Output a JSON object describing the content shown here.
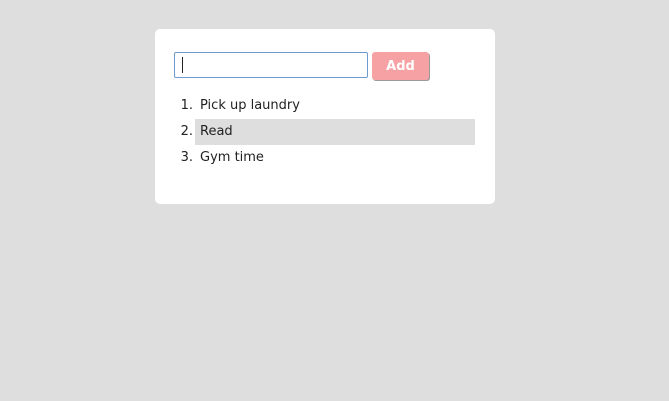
{
  "input": {
    "value": "",
    "placeholder": ""
  },
  "add_button": {
    "label": "Add",
    "color": "#f6a1a3"
  },
  "todos": [
    {
      "number": "1.",
      "text": "Pick up laundry",
      "selected": false
    },
    {
      "number": "2.",
      "text": "Read",
      "selected": true
    },
    {
      "number": "3.",
      "text": "Gym time",
      "selected": false
    }
  ],
  "colors": {
    "background": "#dedede",
    "card": "#ffffff",
    "selected_row": "#dedede",
    "input_border": "#6f9ad0"
  }
}
